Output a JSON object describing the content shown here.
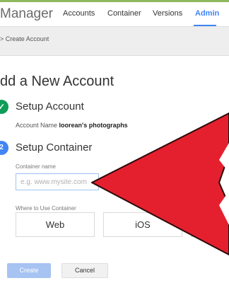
{
  "header": {
    "app_title": "Manager",
    "nav": [
      {
        "label": "Accounts"
      },
      {
        "label": "Container"
      },
      {
        "label": "Versions"
      },
      {
        "label": "Admin",
        "active": true
      }
    ]
  },
  "breadcrumb": "> Create Account",
  "page_title": "dd a New Account",
  "steps": {
    "account": {
      "title": "Setup Account",
      "status_icon": "checkmark-icon",
      "account_name_label": "Account Name",
      "account_name_value": "loorean's photographs"
    },
    "container": {
      "title": "Setup Container",
      "container_name_label": "Container name",
      "container_name_placeholder": "e.g. www.mysite.com",
      "container_name_value": "",
      "where_label": "Where to Use Container",
      "platforms": [
        "Web",
        "iOS"
      ]
    }
  },
  "buttons": {
    "create": "Create",
    "cancel": "Cancel"
  },
  "overlay": {
    "icon": "red-pointer-arrow",
    "color": "#e5202e"
  },
  "colors": {
    "accent": "#4285f4",
    "success": "#0f9d58",
    "top_strip": "#8fb75e"
  }
}
